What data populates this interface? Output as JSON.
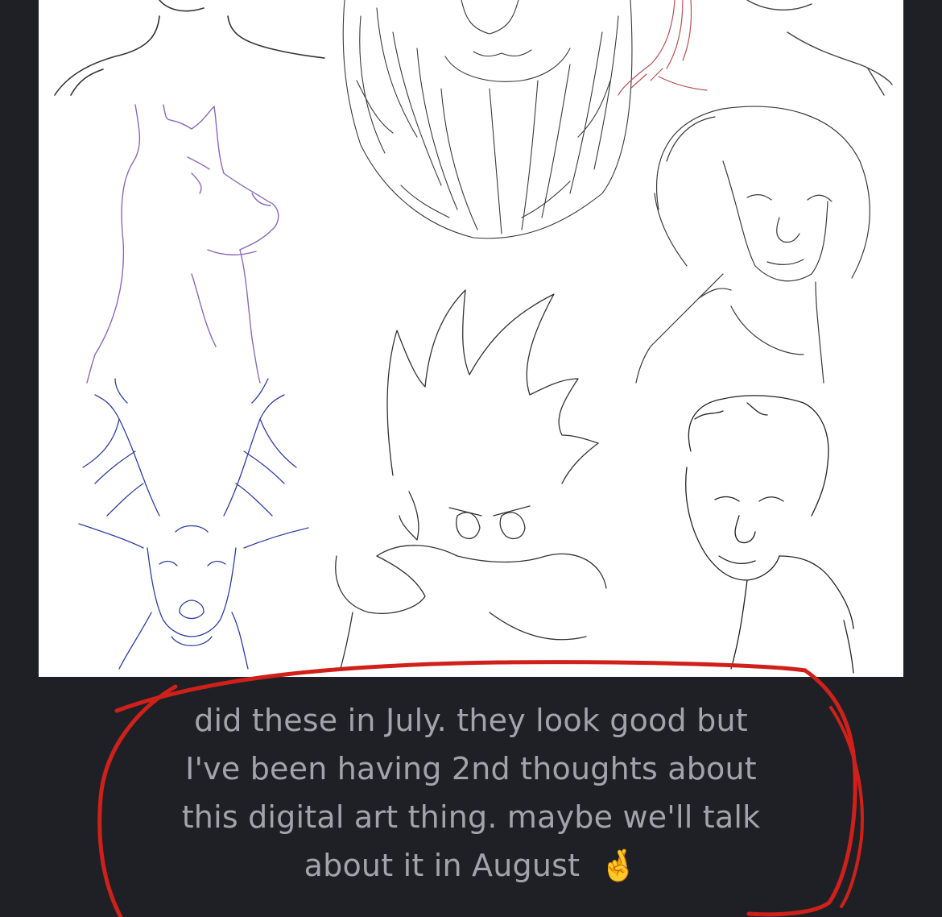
{
  "caption": {
    "lines": [
      "did these in July. they look good but",
      "I've been having 2nd thoughts about",
      "this digital art thing. maybe we'll talk",
      "about it in August"
    ],
    "emoji": "🤞"
  },
  "artwork": {
    "description_icons": [
      "portrait-sketch-icon",
      "lion-sketch-icon",
      "braids-sketch-icon",
      "dog-sketch-icon",
      "woman-sketch-icon",
      "spiky-hair-boy-sketch-icon",
      "deer-sketch-icon",
      "short-hair-woman-sketch-icon"
    ]
  },
  "colors": {
    "background": "#1f2026",
    "caption_text": "#a3a4ab",
    "annotation": "#d0201a",
    "dog_sketch": "#8a6ab8",
    "deer_sketch": "#2f3f9e",
    "braid_sketch": "#b85050"
  }
}
